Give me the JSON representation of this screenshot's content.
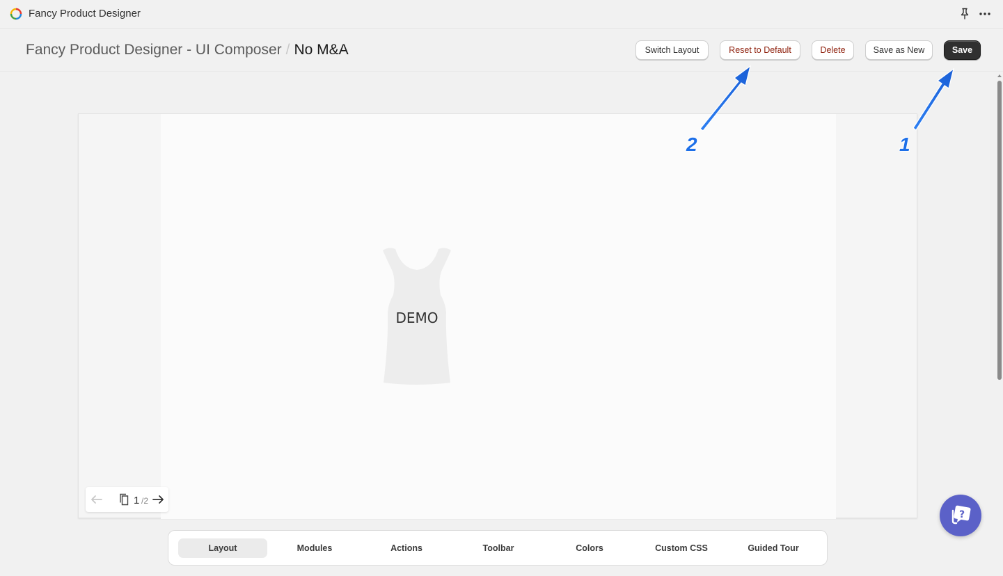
{
  "appbar": {
    "title": "Fancy Product Designer",
    "logo_icon": "fpd-logo-icon",
    "pin_icon": "pin-icon",
    "more_icon": "more-horizontal-icon"
  },
  "header": {
    "breadcrumb_parent": "Fancy Product Designer - UI Composer",
    "breadcrumb_separator": "/",
    "breadcrumb_current": "No M&A",
    "buttons": {
      "switch_layout": "Switch Layout",
      "reset_default": "Reset to Default",
      "delete": "Delete",
      "save_as_new": "Save as New",
      "save": "Save"
    }
  },
  "canvas": {
    "product_label": "DEMO",
    "pager": {
      "current": "1",
      "total": "/2"
    }
  },
  "tabs": [
    {
      "label": "Layout",
      "active": true
    },
    {
      "label": "Modules",
      "active": false
    },
    {
      "label": "Actions",
      "active": false
    },
    {
      "label": "Toolbar",
      "active": false
    },
    {
      "label": "Colors",
      "active": false
    },
    {
      "label": "Custom CSS",
      "active": false
    },
    {
      "label": "Guided Tour",
      "active": false
    }
  ],
  "annotations": {
    "one": "1",
    "two": "2"
  },
  "colors": {
    "annotation_blue": "#1d6fe8",
    "primary_button": "#303030",
    "danger_text": "#8e1f0b",
    "help_fab": "#5b61c8"
  }
}
